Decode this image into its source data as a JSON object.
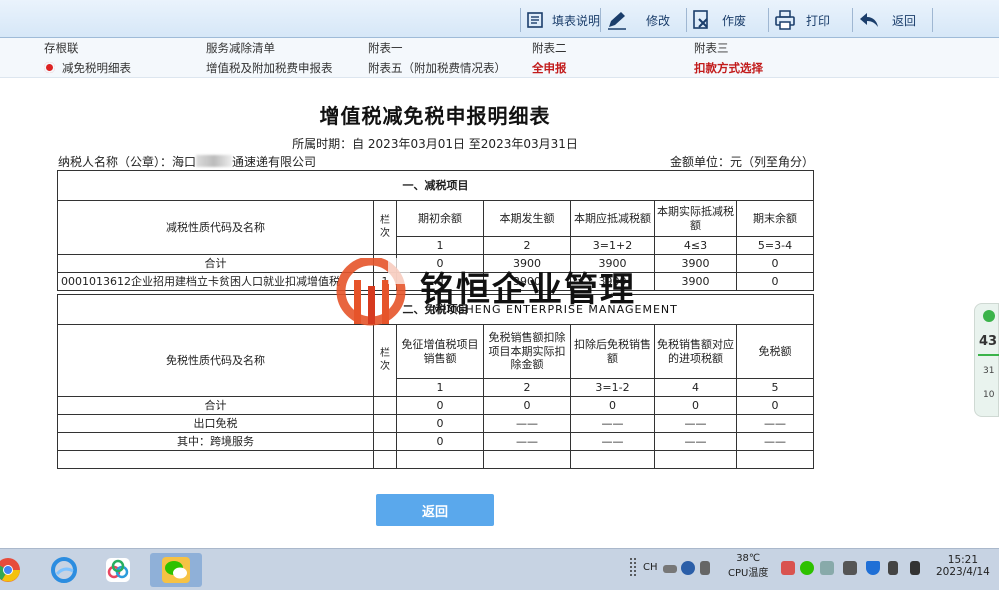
{
  "toolbar": {
    "items": [
      {
        "label": "填表说明",
        "icon": "form-guide-icon"
      },
      {
        "label": "修改",
        "icon": "pencil-icon"
      },
      {
        "label": "作废",
        "icon": "void-document-icon"
      },
      {
        "label": "打印",
        "icon": "printer-icon"
      },
      {
        "label": "返回",
        "icon": "back-arrow-icon"
      }
    ]
  },
  "nav": {
    "row1": [
      "存根联",
      "服务减除清单",
      "附表一",
      "附表二",
      "附表三"
    ],
    "row2": [
      "减免税明细表",
      "增值税及附加税费申报表",
      "附表五（附加税费情况表）",
      "全申报",
      "扣款方式选择"
    ]
  },
  "form": {
    "title": "增值税减免税申报明细表",
    "period": "所属时期：自 2023年03月01日 至2023年03月31日",
    "taxpayer": "纳税人名称（公章）：海口",
    "taxpayer_tail": "通速递有限公司",
    "unit": "金额单位：元（列至角分）"
  },
  "reduction": {
    "section": "一、减税项目",
    "name_header": "减税性质代码及名称",
    "col_no": "栏次",
    "headers": [
      "期初余额",
      "本期发生额",
      "本期应抵减税额",
      "本期实际抵减税额",
      "期末余额"
    ],
    "formulas": [
      "1",
      "2",
      "3=1+2",
      "4≤3",
      "5=3-4"
    ],
    "rows": [
      {
        "name": "合计",
        "no": "",
        "values": [
          "0",
          "3900",
          "3900",
          "3900",
          "0"
        ]
      },
      {
        "name": "0001013612企业招用建档立卡贫困人口就业扣减增值税",
        "no": "1",
        "values": [
          "0",
          "3900",
          "3900",
          "3900",
          "0"
        ]
      }
    ]
  },
  "exemption": {
    "section": "二、免税项目",
    "name_header": "免税性质代码及名称",
    "col_no": "栏次",
    "headers": [
      "免征增值税项目销售额",
      "免税销售额扣除项目本期实际扣除金额",
      "扣除后免税销售额",
      "免税销售额对应的进项税额",
      "免税额"
    ],
    "formulas": [
      "1",
      "2",
      "3=1-2",
      "4",
      "5"
    ],
    "rows": [
      {
        "name": "合计",
        "values": [
          "0",
          "0",
          "0",
          "0",
          "0"
        ]
      },
      {
        "name": "出口免税",
        "values": [
          "0",
          "——",
          "——",
          "——",
          "——"
        ]
      },
      {
        "name": "其中：跨境服务",
        "values": [
          "0",
          "——",
          "——",
          "——",
          "——"
        ]
      }
    ]
  },
  "return_button": "返回",
  "watermark": {
    "name": "铭恒企业管理",
    "english": "MINGHENG ENTERPRISE MANAGEMENT"
  },
  "widget": {
    "value": "43",
    "up": "31",
    "down": "10"
  },
  "taskbar": {
    "temp": "38℃",
    "cpu": "CPU温度",
    "time": "15:21",
    "date": "2023/4/14",
    "ime": "CH"
  }
}
